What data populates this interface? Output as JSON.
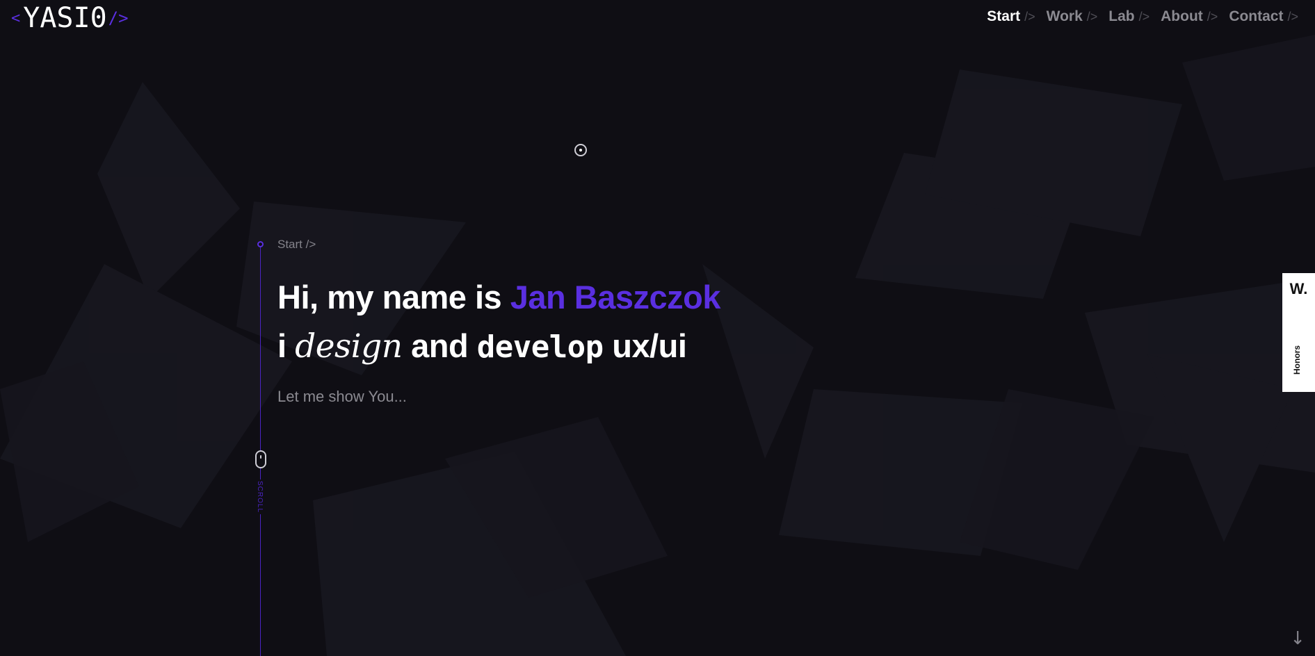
{
  "logo": {
    "prefix": "<",
    "name": "YASI0",
    "suffix": "/>"
  },
  "nav": {
    "items": [
      {
        "label": "Start",
        "sep": "/>",
        "active": true
      },
      {
        "label": "Work",
        "sep": "/>",
        "active": false
      },
      {
        "label": "Lab",
        "sep": "/>",
        "active": false
      },
      {
        "label": "About",
        "sep": "/>",
        "active": false
      },
      {
        "label": "Contact",
        "sep": "/>",
        "active": false
      }
    ]
  },
  "hero": {
    "section_label": "Start />",
    "line1_prefix": "Hi, my name is ",
    "line1_name": "Jan Baszczok",
    "line2_i": "i ",
    "line2_design": "design",
    "line2_and": " and ",
    "line2_develop": "develop",
    "line2_tail": " ux/ui",
    "subline": "Let me show You..."
  },
  "scroll": {
    "label": "SCROLL",
    "icon": "mouse-icon"
  },
  "honors": {
    "logo": "W.",
    "label": "Honors"
  },
  "icons": {
    "target": "target-dot-icon",
    "down_arrow": "arrow-down-icon",
    "down_arrow_glyph": "↓"
  },
  "colors": {
    "background": "#0f0e14",
    "accent": "#5a2fe0",
    "text": "#ffffff",
    "muted": "#8b8a91"
  }
}
